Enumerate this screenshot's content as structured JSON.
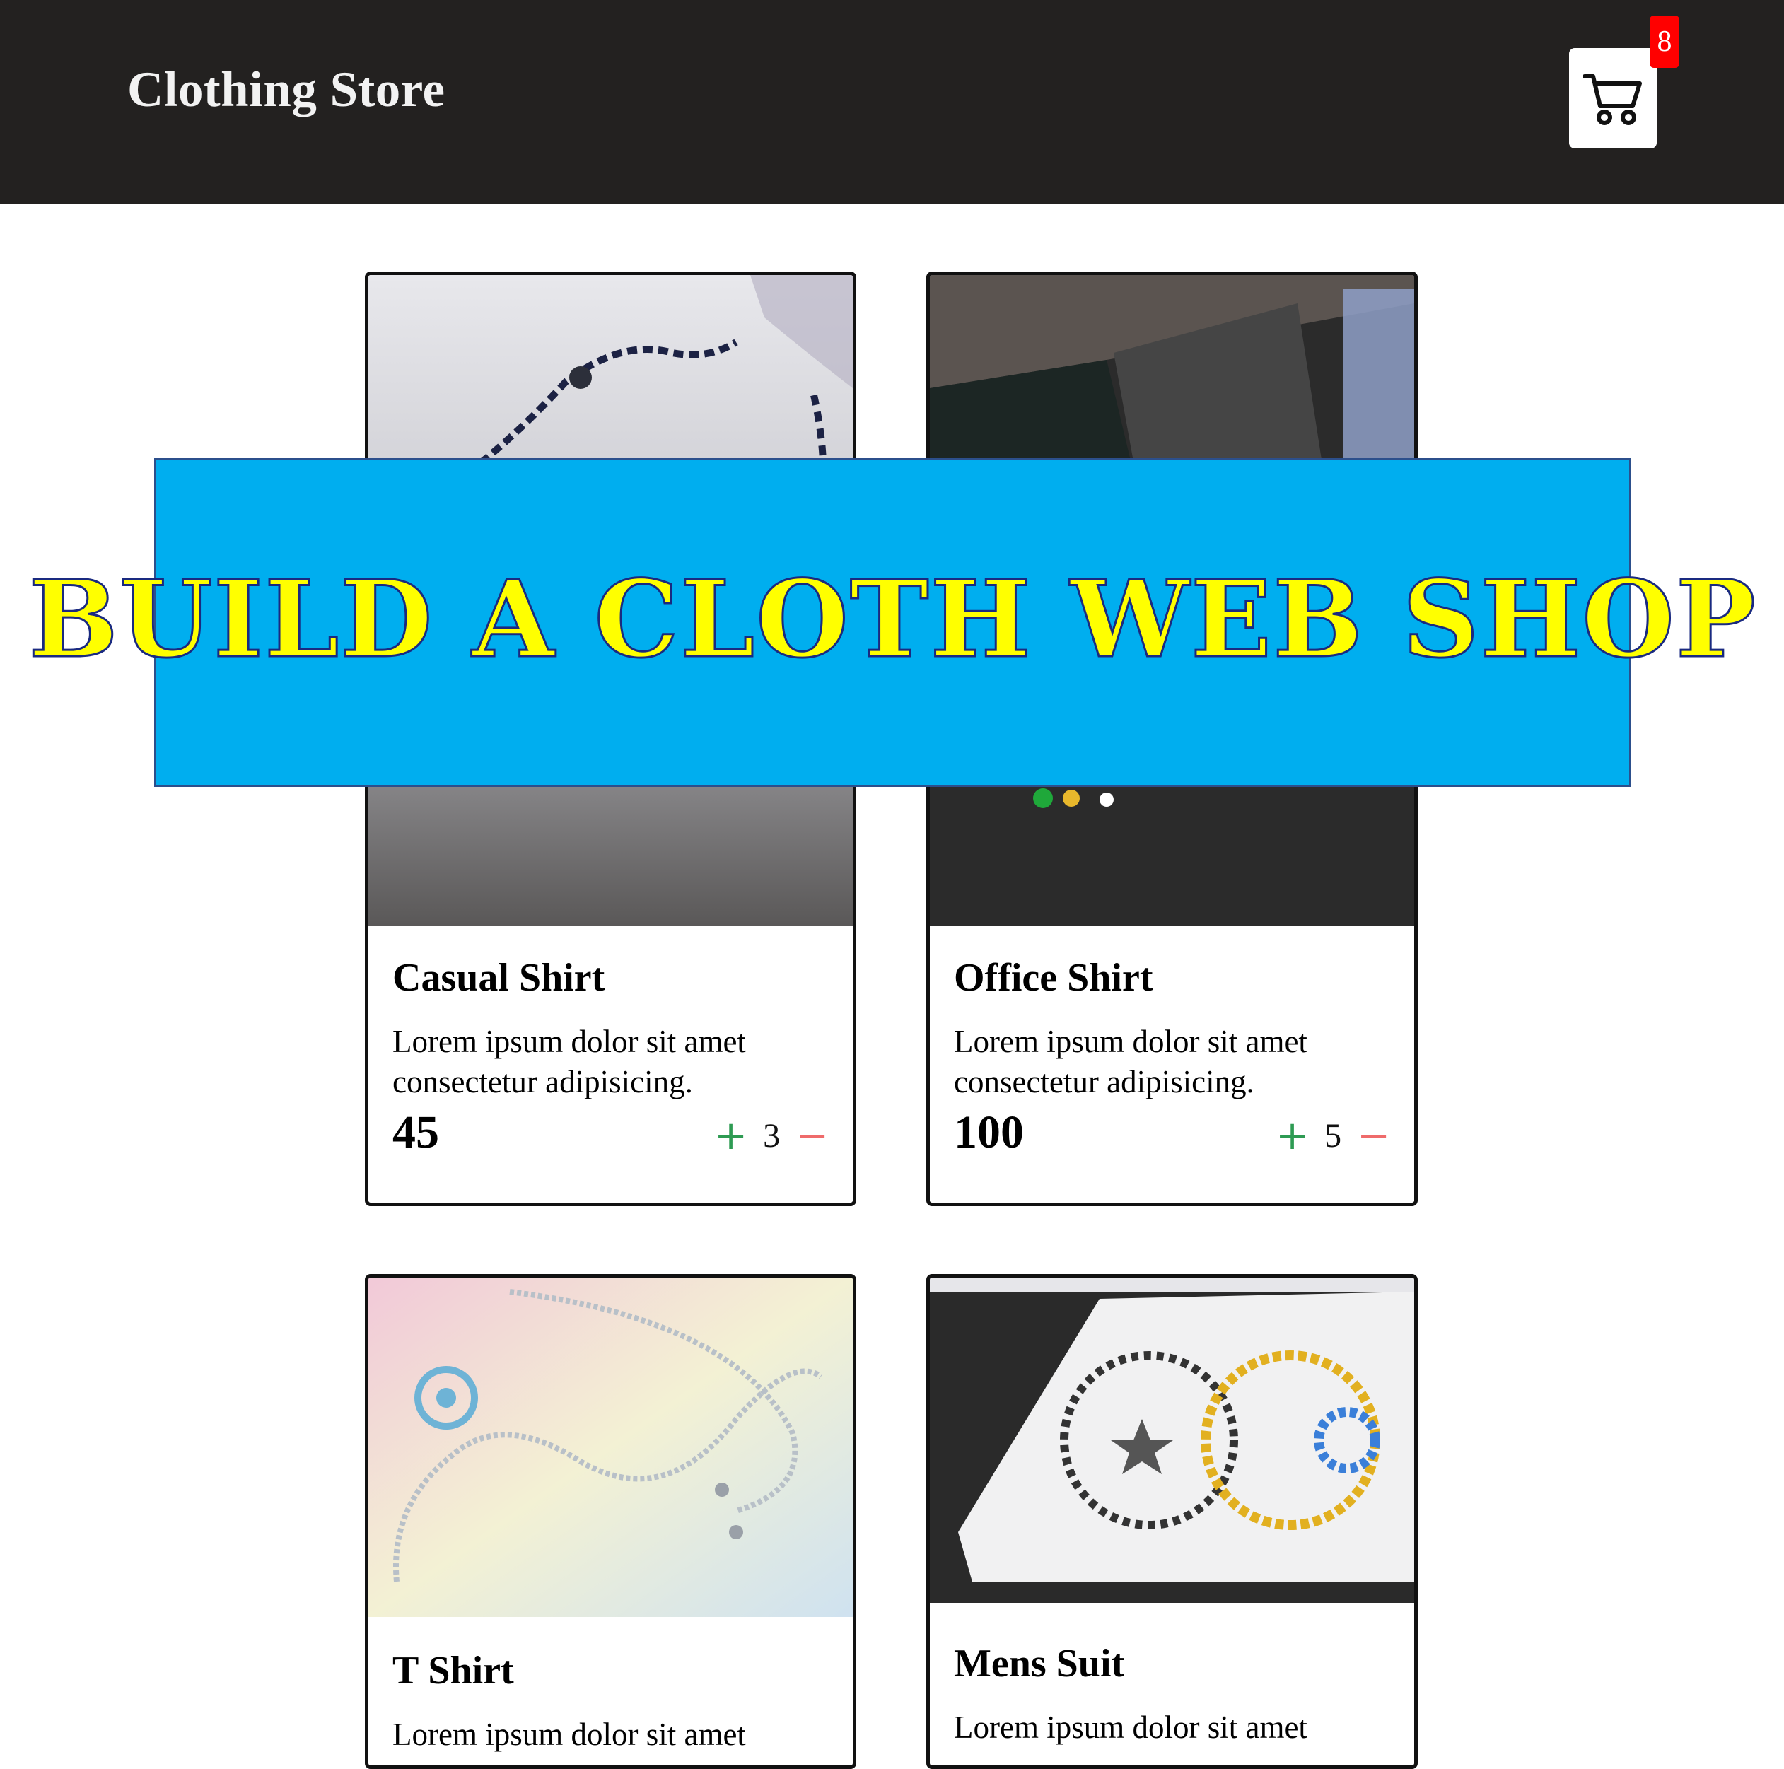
{
  "header": {
    "brand": "Clothing Store",
    "cart_count": "8"
  },
  "icons": {
    "cart": "shopping-cart-icon",
    "plus": "plus-icon",
    "minus": "minus-icon"
  },
  "colors": {
    "header_bg": "#232120",
    "badge": "#ff0000",
    "banner_bg": "#00aeef",
    "banner_text": "#ffff00",
    "plus": "#2e9b53",
    "minus": "#ef6b6b"
  },
  "banner": {
    "text": "Build a Cloth Web Shop"
  },
  "products": [
    {
      "title": "Casual Shirt",
      "description": "Lorem ipsum dolor sit amet consectetur adipisicing.",
      "price": "45",
      "quantity": "3",
      "plus": "+",
      "minus": "−"
    },
    {
      "title": "Office Shirt",
      "description": "Lorem ipsum dolor sit amet consectetur adipisicing.",
      "price": "100",
      "quantity": "5",
      "plus": "+",
      "minus": "−"
    },
    {
      "title": "T Shirt",
      "description": "Lorem ipsum dolor sit amet"
    },
    {
      "title": "Mens Suit",
      "description": "Lorem ipsum dolor sit amet"
    }
  ]
}
